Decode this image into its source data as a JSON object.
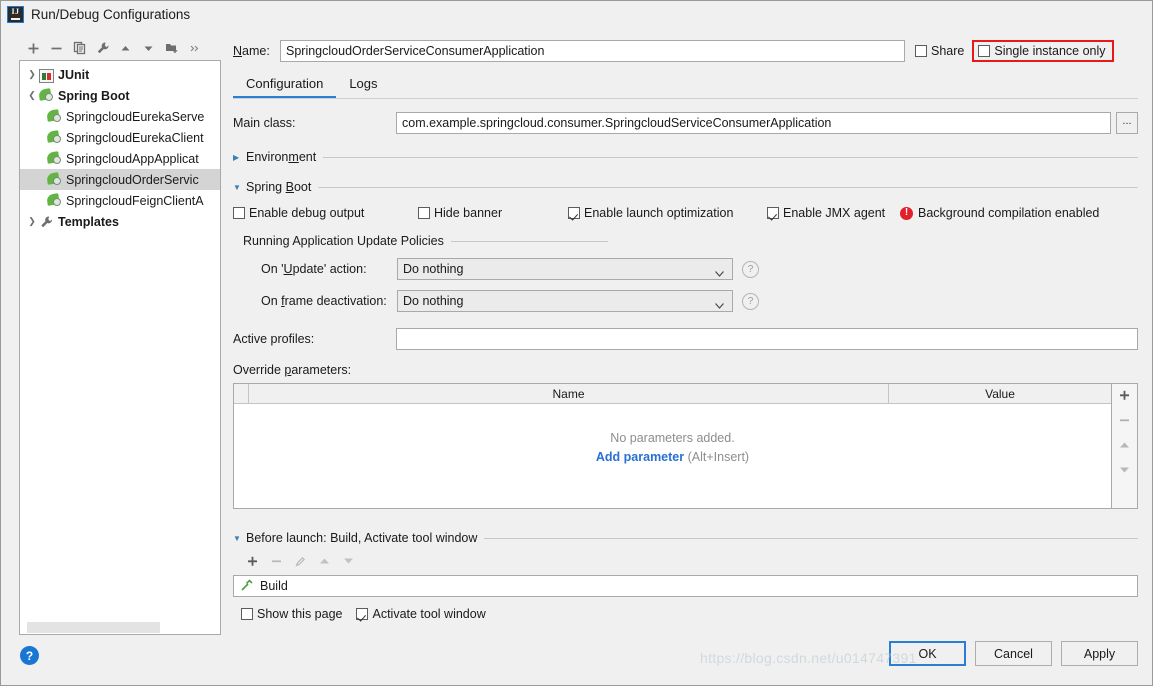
{
  "window": {
    "title": "Run/Debug Configurations",
    "app_icon": "intellij-idea-icon"
  },
  "tree_toolbar": {
    "buttons": [
      {
        "name": "add-configuration",
        "icon": "plus-icon"
      },
      {
        "name": "remove-configuration",
        "icon": "minus-icon"
      },
      {
        "name": "copy-configuration",
        "icon": "copy-icon"
      },
      {
        "name": "edit-templates",
        "icon": "wrench-icon"
      },
      {
        "name": "move-up",
        "icon": "arrow-up-icon"
      },
      {
        "name": "move-down",
        "icon": "arrow-down-icon"
      },
      {
        "name": "new-folder",
        "icon": "folder-add-icon"
      },
      {
        "name": "more-options",
        "icon": "chevron-double-right-icon"
      }
    ]
  },
  "tree": {
    "nodes": [
      {
        "label": "JUnit",
        "icon": "junit-icon",
        "bold": true,
        "level": 0,
        "expanded": false,
        "selected": false
      },
      {
        "label": "Spring Boot",
        "icon": "spring-boot-icon",
        "bold": true,
        "level": 0,
        "expanded": true,
        "selected": false
      },
      {
        "label": "SpringcloudEurekaServe",
        "icon": "spring-boot-icon",
        "bold": false,
        "level": 1,
        "selected": false
      },
      {
        "label": "SpringcloudEurekaClient",
        "icon": "spring-boot-icon",
        "bold": false,
        "level": 1,
        "selected": false
      },
      {
        "label": "SpringcloudAppApplicat",
        "icon": "spring-boot-icon",
        "bold": false,
        "level": 1,
        "selected": false
      },
      {
        "label": "SpringcloudOrderServic",
        "icon": "spring-boot-icon",
        "bold": false,
        "level": 1,
        "selected": true
      },
      {
        "label": "SpringcloudFeignClientA",
        "icon": "spring-boot-icon",
        "bold": false,
        "level": 1,
        "selected": false
      },
      {
        "label": "Templates",
        "icon": "wrench-icon",
        "bold": true,
        "level": 0,
        "expanded": false,
        "selected": false
      }
    ]
  },
  "header": {
    "name_label": "Name:",
    "name_value": "SpringcloudOrderServiceConsumerApplication",
    "share_label": "Share",
    "share_checked": false,
    "single_instance_label": "Single instance only",
    "single_instance_checked": false,
    "highlight_color": "#e81919"
  },
  "tabs": [
    {
      "label": "Configuration",
      "active": true
    },
    {
      "label": "Logs",
      "active": false
    }
  ],
  "main_class": {
    "label": "Main class:",
    "value": "com.example.springcloud.consumer.SpringcloudServiceConsumerApplication",
    "browse_label": "..."
  },
  "environment_section": {
    "title": "Environment",
    "expanded": false
  },
  "spring_boot_section": {
    "title": "Spring Boot",
    "expanded": true,
    "checkboxes": [
      {
        "label": "Enable debug output",
        "checked": false
      },
      {
        "label": "Hide banner",
        "checked": false
      },
      {
        "label": "Enable launch optimization",
        "checked": true
      },
      {
        "label": "Enable JMX agent",
        "checked": true
      }
    ],
    "warning": {
      "icon": "error-icon",
      "label": "Background compilation enabled",
      "color": "#e0202a"
    },
    "update_policies": {
      "title": "Running Application Update Policies",
      "rows": [
        {
          "label": "On 'Update' action:",
          "value": "Do nothing",
          "help": "?"
        },
        {
          "label": "On frame deactivation:",
          "value": "Do nothing",
          "help": "?"
        }
      ]
    },
    "active_profiles": {
      "label": "Active profiles:",
      "value": "",
      "placeholder": ""
    },
    "override_parameters": {
      "label": "Override parameters:",
      "columns": [
        "",
        "Name",
        "Value"
      ],
      "rows": [],
      "empty_text": "No parameters added.",
      "add_link": "Add parameter",
      "add_hint": "(Alt+Insert)",
      "side_buttons": [
        {
          "name": "add-parameter-button",
          "icon": "plus-icon"
        },
        {
          "name": "remove-parameter-button",
          "icon": "minus-icon"
        },
        {
          "name": "move-parameter-up-button",
          "icon": "arrow-up-icon"
        },
        {
          "name": "move-parameter-down-button",
          "icon": "arrow-down-icon"
        }
      ]
    }
  },
  "before_launch": {
    "title": "Before launch: Build, Activate tool window",
    "expanded": true,
    "toolbar": [
      {
        "name": "add-task-button",
        "icon": "plus-icon"
      },
      {
        "name": "remove-task-button",
        "icon": "minus-icon"
      },
      {
        "name": "edit-task-button",
        "icon": "pencil-icon"
      },
      {
        "name": "move-task-up-button",
        "icon": "arrow-up-icon"
      },
      {
        "name": "move-task-down-button",
        "icon": "arrow-down-icon"
      }
    ],
    "tasks": [
      {
        "label": "Build",
        "icon": "build-hammer-icon"
      }
    ],
    "show_this_page": {
      "label": "Show this page",
      "checked": false
    },
    "activate_tool_window": {
      "label": "Activate tool window",
      "checked": true
    }
  },
  "footer": {
    "help_icon": "help-icon",
    "buttons": [
      {
        "label": "OK",
        "default": true
      },
      {
        "label": "Cancel",
        "default": false
      },
      {
        "label": "Apply",
        "default": false
      }
    ],
    "watermark": "https://blog.csdn.net/u014747391"
  }
}
